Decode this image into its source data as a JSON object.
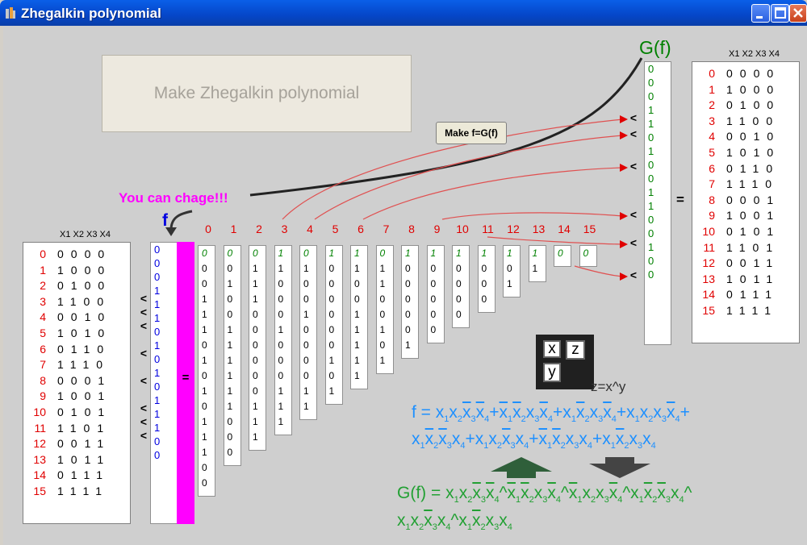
{
  "window": {
    "title": "Zhegalkin polynomial"
  },
  "buttons": {
    "make_polynomial": "Make  Zhegalkin polynomial",
    "make_fg": "Make f=G(f)"
  },
  "labels": {
    "can_change": "You can chage!!!",
    "f": "f",
    "gf": "G(f)",
    "equals": "=",
    "zxy": "z=x^y",
    "cols_header_left": "X1 X2 X3 X4",
    "cols_header_right": "X1 X2 X3 X4",
    "legend_x": "x",
    "legend_z": "z",
    "legend_y": "y"
  },
  "truth_table": {
    "rows": [
      "0",
      "1",
      "2",
      "3",
      "4",
      "5",
      "6",
      "7",
      "8",
      "9",
      "10",
      "11",
      "12",
      "13",
      "14",
      "15"
    ],
    "bits": [
      "0000",
      "1000",
      "0100",
      "1100",
      "0010",
      "1010",
      "0110",
      "1110",
      "0001",
      "1001",
      "0101",
      "1101",
      "0011",
      "1011",
      "0111",
      "1111"
    ]
  },
  "f_values": [
    "0",
    "0",
    "0",
    "1",
    "1",
    "1",
    "0",
    "1",
    "0",
    "1",
    "0",
    "1",
    "1",
    "1",
    "0",
    "0"
  ],
  "f_change_marks": [
    "",
    "",
    "",
    "<",
    "<",
    "<",
    "",
    "<",
    "",
    "<",
    "",
    "<",
    "<",
    "<",
    "",
    ""
  ],
  "g_values": [
    "0",
    "0",
    "0",
    "1",
    "1",
    "0",
    "1",
    "0",
    "0",
    "1",
    "1",
    "0",
    "0",
    "1",
    "0",
    "0"
  ],
  "diff_columns": [
    [
      "0",
      "0",
      "0",
      "1",
      "1",
      "1",
      "0",
      "1",
      "0",
      "1",
      "0",
      "1",
      "1",
      "1",
      "0",
      "0"
    ],
    [
      "0",
      "0",
      "1",
      "0",
      "0",
      "1",
      "1",
      "1",
      "1",
      "1",
      "1",
      "0",
      "0",
      "0"
    ],
    [
      "0",
      "1",
      "1",
      "1",
      "0",
      "0",
      "0",
      "0",
      "0",
      "0",
      "1",
      "1",
      "1"
    ],
    [
      "1",
      "1",
      "0",
      "0",
      "0",
      "1",
      "0",
      "0",
      "0",
      "1",
      "1",
      "1"
    ],
    [
      "0",
      "1",
      "0",
      "0",
      "1",
      "0",
      "0",
      "0",
      "0",
      "1",
      "1"
    ],
    [
      "1",
      "0",
      "0",
      "0",
      "0",
      "0",
      "0",
      "1",
      "0",
      "1"
    ],
    [
      "1",
      "1",
      "0",
      "0",
      "1",
      "1",
      "1",
      "1",
      "1"
    ],
    [
      "0",
      "1",
      "1",
      "0",
      "0",
      "1",
      "0",
      "1"
    ],
    [
      "1",
      "0",
      "0",
      "0",
      "0",
      "0",
      "1"
    ],
    [
      "1",
      "0",
      "0",
      "0",
      "0",
      "0"
    ],
    [
      "1",
      "0",
      "0",
      "0",
      "0"
    ],
    [
      "1",
      "0",
      "0",
      "0"
    ],
    [
      "1",
      "0",
      "1"
    ],
    [
      "1",
      "1"
    ],
    [
      "0"
    ],
    [
      "0"
    ]
  ],
  "column_titles": [
    "0",
    "1",
    "2",
    "3",
    "4",
    "5",
    "6",
    "7",
    "8",
    "9",
    "10",
    "11",
    "12",
    "13",
    "14",
    "15"
  ],
  "formulas": {
    "f_line1": "f = x1x2x3x4+x1x2x3x4+x1x2x3x4+x1x2x3x4+",
    "f_line2": "x1x2x3x4+x1x2x3x4+x1x2x3x4+x1x2x3x4",
    "g_line1": "G(f) = x1x2x3x4^x1x2x3x4^x1x2x3x4^x1x2x3x4^",
    "g_line2": "x1x2x3x4^x1x2x3x4"
  },
  "colors": {
    "red": "#e00000",
    "blue": "#0000e0",
    "green": "#008000",
    "magenta": "#ff00ff",
    "formula_blue": "#1e90ff",
    "formula_green": "#22a033"
  }
}
